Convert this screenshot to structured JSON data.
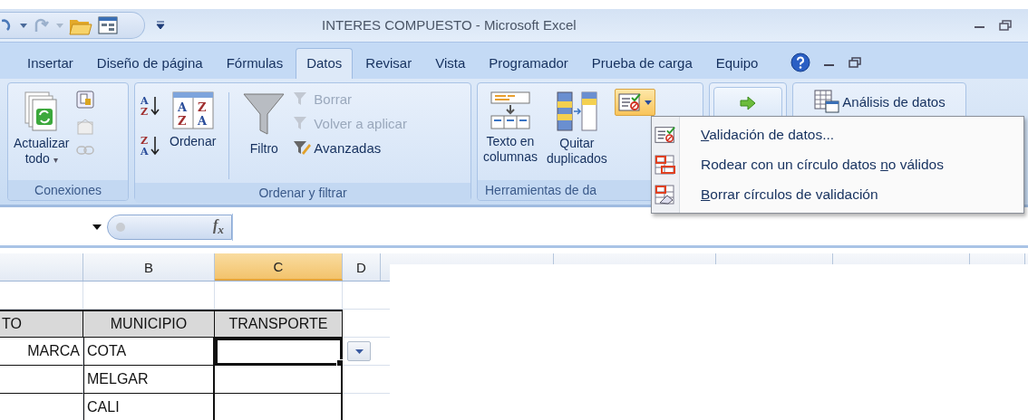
{
  "window": {
    "title": "INTERES COMPUESTO - Microsoft Excel"
  },
  "tabs": [
    {
      "label": "Insertar",
      "selected": false
    },
    {
      "label": "Diseño de página",
      "selected": false
    },
    {
      "label": "Fórmulas",
      "selected": false
    },
    {
      "label": "Datos",
      "selected": true
    },
    {
      "label": "Revisar",
      "selected": false
    },
    {
      "label": "Vista",
      "selected": false
    },
    {
      "label": "Programador",
      "selected": false
    },
    {
      "label": "Prueba de carga",
      "selected": false
    },
    {
      "label": "Equipo",
      "selected": false
    }
  ],
  "ribbon": {
    "connections": {
      "label": "Conexiones",
      "refresh_lines": [
        "Actualizar",
        "todo"
      ],
      "refresh_caret": "▾"
    },
    "sort_filter": {
      "label": "Ordenar y filtrar",
      "sort_label": "Ordenar",
      "sort_ascending_letters": [
        "A",
        "Z"
      ],
      "sort_descending_letters": [
        "Z",
        "A"
      ],
      "sort_dialog_letters": [
        "A",
        "Z",
        "Z",
        "A"
      ],
      "filter_label": "Filtro",
      "commands": [
        {
          "label": "Borrar",
          "disabled": true
        },
        {
          "label": "Volver a aplicar",
          "disabled": true
        },
        {
          "label": "Avanzadas",
          "disabled": false
        }
      ]
    },
    "data_tools": {
      "label": "Herramientas de da",
      "text_to_columns": [
        "Texto en",
        "columnas"
      ],
      "remove_duplicates": [
        "Quitar",
        "duplicados"
      ],
      "validation_open": true
    },
    "analysis": {
      "label": "Análisis de datos"
    }
  },
  "dropdown_menu": {
    "items": [
      {
        "key": "V",
        "after": "alidación de datos..."
      },
      {
        "before": "Rodear con un círculo datos ",
        "key": "n",
        "after": "o válidos"
      },
      {
        "key": "B",
        "after": "orrar círculos de validación"
      }
    ]
  },
  "formula_bar": {
    "fx_label": "f$_{x}$"
  },
  "sheet": {
    "columns": [
      {
        "letter": "B",
        "selected": false
      },
      {
        "letter": "C",
        "selected": true
      },
      {
        "letter": "D",
        "selected": false
      }
    ],
    "rows": [
      {
        "kind": "blank"
      },
      {
        "kind": "header",
        "a": "TO",
        "b": "MUNICIPIO",
        "c": "TRANSPORTE"
      },
      {
        "kind": "data",
        "a": "MARCA",
        "b": "COTA",
        "c_selected": true
      },
      {
        "kind": "data",
        "b": "MELGAR",
        "c_selected": false
      },
      {
        "kind": "data",
        "b": "CALI",
        "c_selected": false
      }
    ]
  }
}
